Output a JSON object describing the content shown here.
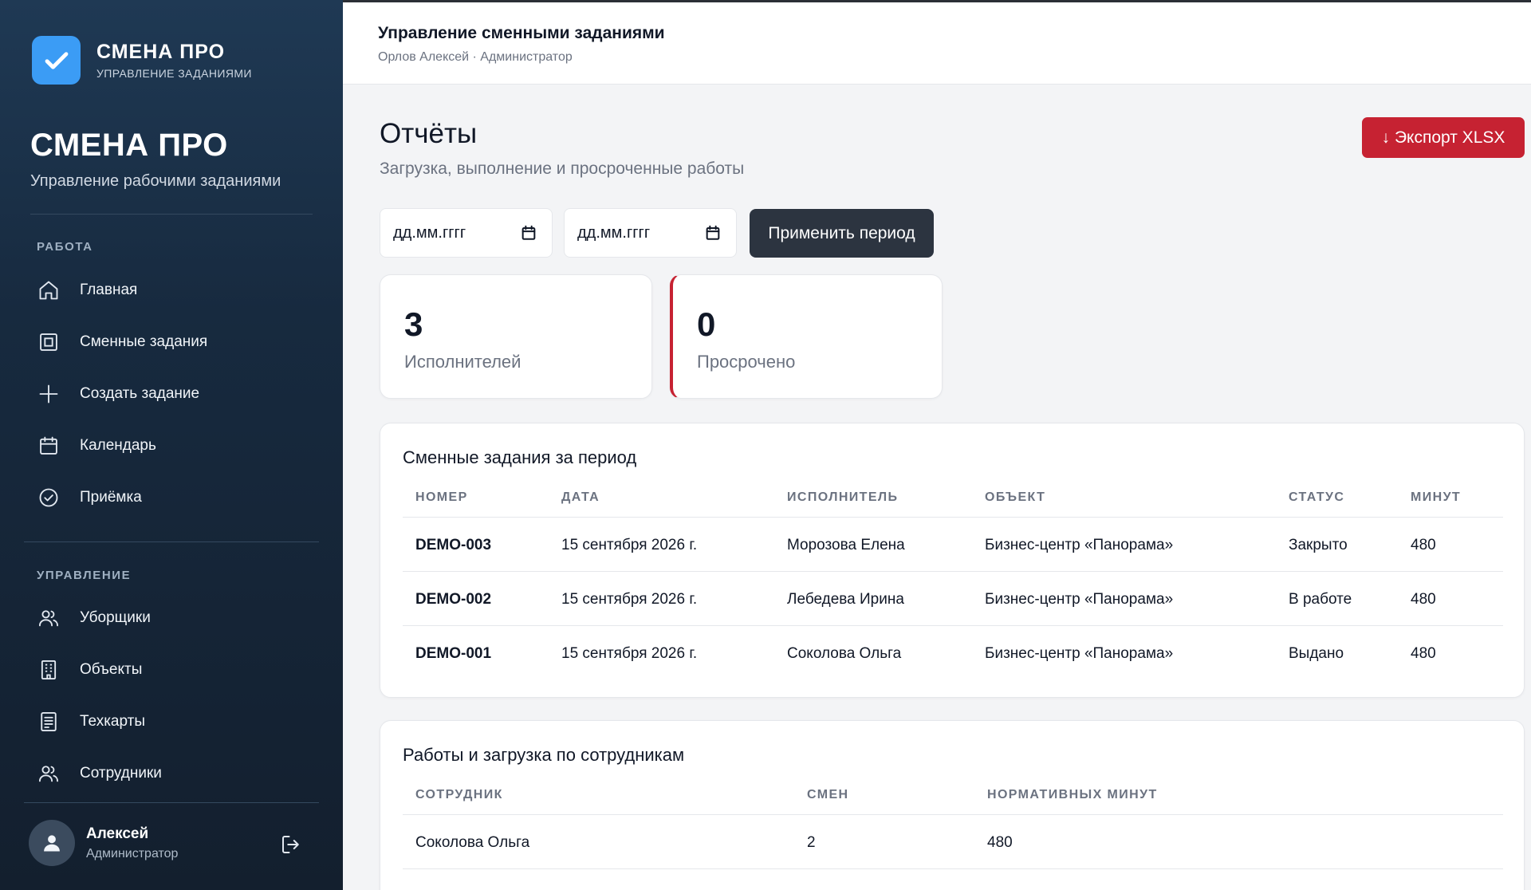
{
  "sidebar": {
    "brand_title": "СМЕНА ПРО",
    "brand_subtitle": "УПРАВЛЕНИЕ ЗАДАНИЯМИ",
    "title": "СМЕНА ПРО",
    "subtitle": "Управление рабочими заданиями",
    "section_work": "РАБОТА",
    "work_items": [
      {
        "label": "Главная",
        "icon": "home-icon"
      },
      {
        "label": "Сменные задания",
        "icon": "square-icon"
      },
      {
        "label": "Создать задание",
        "icon": "plus-icon"
      },
      {
        "label": "Календарь",
        "icon": "calendar-icon"
      },
      {
        "label": "Приёмка",
        "icon": "check-circle-icon"
      }
    ],
    "section_manage": "УПРАВЛЕНИЕ",
    "manage_items": [
      {
        "label": "Уборщики",
        "icon": "users-icon"
      },
      {
        "label": "Объекты",
        "icon": "building-icon"
      },
      {
        "label": "Техкарты",
        "icon": "document-icon"
      },
      {
        "label": "Сотрудники",
        "icon": "users-icon"
      }
    ],
    "user": {
      "name": "Алексей",
      "role": "Администратор"
    }
  },
  "header": {
    "title": "Управление сменными заданиями",
    "subtitle": "Орлов Алексей · Администратор"
  },
  "main": {
    "title": "Отчёты",
    "subtitle": "Загрузка, выполнение и просроченные работы",
    "export_label": "↓ Экспорт XLSX",
    "date_from_placeholder": "дд.мм.гггг",
    "date_to_placeholder": "дд.мм.гггг",
    "apply_label": "Применить период",
    "stats": [
      {
        "value": "3",
        "label": "Исполнителей"
      },
      {
        "value": "0",
        "label": "Просрочено"
      }
    ]
  },
  "shifts_table": {
    "title": "Сменные задания за период",
    "columns": [
      "НОМЕР",
      "ДАТА",
      "ИСПОЛНИТЕЛЬ",
      "ОБЪЕКТ",
      "СТАТУС",
      "МИНУТ"
    ],
    "rows": [
      [
        "DEMO-003",
        "15 сентября 2026 г.",
        "Морозова Елена",
        "Бизнес-центр «Панорама»",
        "Закрыто",
        "480"
      ],
      [
        "DEMO-002",
        "15 сентября 2026 г.",
        "Лебедева Ирина",
        "Бизнес-центр «Панорама»",
        "В работе",
        "480"
      ],
      [
        "DEMO-001",
        "15 сентября 2026 г.",
        "Соколова Ольга",
        "Бизнес-центр «Панорама»",
        "Выдано",
        "480"
      ]
    ]
  },
  "workload_table": {
    "title": "Работы и загрузка по сотрудникам",
    "columns": [
      "СОТРУДНИК",
      "СМЕН",
      "НОРМАТИВНЫХ МИНУТ"
    ],
    "rows": [
      [
        "Соколова Ольга",
        "2",
        "480"
      ]
    ]
  },
  "colors": {
    "sidebar_bg": "#172a3f",
    "brand_logo": "#3b9cf5",
    "danger": "#c62232",
    "primary_button": "#2c3440"
  }
}
